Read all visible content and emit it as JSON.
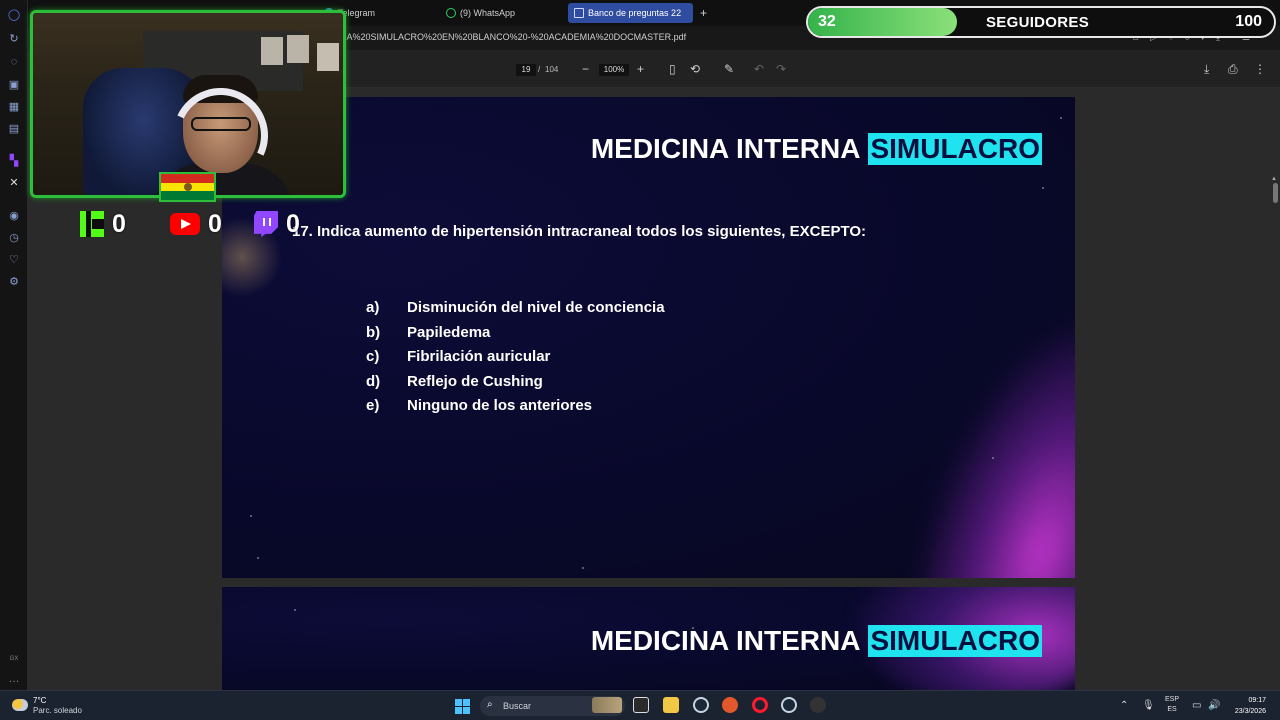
{
  "browser": {
    "tabs": [
      {
        "label": "",
        "icon": "youtube-icon"
      },
      {
        "label": "Telegram",
        "icon": "telegram-icon"
      },
      {
        "label": "(9) WhatsApp",
        "icon": "whatsapp-icon"
      },
      {
        "label": "Banco de preguntas 22",
        "icon": "pdf-doc-icon",
        "active": true
      }
    ],
    "new_tab_label": "+",
    "url": "RA%20SIMULACRO%20EN%20BLANCO%20-%20ACADEMIA%20DOCMASTER.pdf"
  },
  "pdf_toolbar": {
    "current_page": "19",
    "page_separator": "/",
    "total_pages": "104",
    "zoom": "100%"
  },
  "slides": [
    {
      "title_main": "MEDICINA INTERNA",
      "title_highlight": "SIMULACRO",
      "question": "17. Indica aumento de hipertensión intracraneal todos los siguientes, EXCEPTO:",
      "options": [
        {
          "letter": "a)",
          "text": "Disminución del nivel de conciencia"
        },
        {
          "letter": "b)",
          "text": "Papiledema"
        },
        {
          "letter": "c)",
          "text": "Fibrilación auricular"
        },
        {
          "letter": "d)",
          "text": "Reflejo de Cushing"
        },
        {
          "letter": "e)",
          "text": "Ninguno de los anteriores"
        }
      ]
    },
    {
      "title_main": "MEDICINA INTERNA",
      "title_highlight": "SIMULACRO"
    }
  ],
  "overlay": {
    "social_counts": [
      {
        "platform": "kick",
        "count": "0"
      },
      {
        "platform": "youtube",
        "count": "0"
      },
      {
        "platform": "twitch",
        "count": "0"
      }
    ],
    "followers": {
      "current": "32",
      "label": "SEGUIDORES",
      "goal": "100",
      "progress_fraction": 0.32,
      "fill_color": "#34b34a"
    }
  },
  "taskbar": {
    "weather_temp": "7°C",
    "weather_desc": "Parc. soleado",
    "search_placeholder": "Buscar",
    "lang_top": "ESP",
    "lang_bottom": "ES",
    "time": "09:17",
    "date": "23/3/2026"
  },
  "colors": {
    "accent_tab": "#2f4da0",
    "title_highlight_bg": "#1fe3ee",
    "slide_bg": "#08082a",
    "overlay_green": "#2dbe3c"
  }
}
